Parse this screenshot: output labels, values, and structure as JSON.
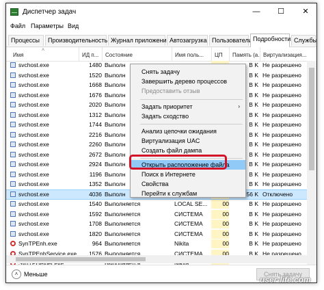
{
  "window": {
    "title": "Диспетчер задач",
    "minimize_glyph": "—",
    "maximize_glyph": "☐",
    "close_glyph": "✕"
  },
  "menu": [
    "Файл",
    "Параметры",
    "Вид"
  ],
  "tabs": [
    "Процессы",
    "Производительность",
    "Журнал приложений",
    "Автозагрузка",
    "Пользователи",
    "Подробности",
    "Службы"
  ],
  "active_tab": "Подробности",
  "columns": [
    "Имя",
    "ИД п...",
    "Состояние",
    "Имя поль...",
    "ЦП",
    "Память (а...",
    "Виртуализация..."
  ],
  "rows": [
    {
      "name": "svchost.exe",
      "pid": "1480",
      "status": "Выполн",
      "user": "",
      "cpu": "",
      "mem": "B K",
      "virt": "Не разрешено",
      "icon": "service"
    },
    {
      "name": "svchost.exe",
      "pid": "1520",
      "status": "Выполн",
      "user": "",
      "cpu": "",
      "mem": "B K",
      "virt": "Не разрешено",
      "icon": "service"
    },
    {
      "name": "svchost.exe",
      "pid": "1668",
      "status": "Выполн",
      "user": "",
      "cpu": "",
      "mem": "B K",
      "virt": "Не разрешено",
      "icon": "service"
    },
    {
      "name": "svchost.exe",
      "pid": "1676",
      "status": "Выполн",
      "user": "",
      "cpu": "",
      "mem": "B K",
      "virt": "Не разрешено",
      "icon": "service"
    },
    {
      "name": "svchost.exe",
      "pid": "2020",
      "status": "Выполн",
      "user": "",
      "cpu": "",
      "mem": "B K",
      "virt": "Не разрешено",
      "icon": "service"
    },
    {
      "name": "svchost.exe",
      "pid": "1312",
      "status": "Выполн",
      "user": "",
      "cpu": "",
      "mem": "B K",
      "virt": "Не разрешено",
      "icon": "service"
    },
    {
      "name": "svchost.exe",
      "pid": "1744",
      "status": "Выполн",
      "user": "",
      "cpu": "",
      "mem": "B K",
      "virt": "Не разрешено",
      "icon": "service"
    },
    {
      "name": "svchost.exe",
      "pid": "2216",
      "status": "Выполн",
      "user": "",
      "cpu": "",
      "mem": "B K",
      "virt": "Не разрешено",
      "icon": "service"
    },
    {
      "name": "svchost.exe",
      "pid": "2260",
      "status": "Выполн",
      "user": "",
      "cpu": "",
      "mem": "B K",
      "virt": "Не разрешено",
      "icon": "service"
    },
    {
      "name": "svchost.exe",
      "pid": "2672",
      "status": "Выполн",
      "user": "",
      "cpu": "",
      "mem": "B K",
      "virt": "Не разрешено",
      "icon": "service"
    },
    {
      "name": "svchost.exe",
      "pid": "2924",
      "status": "Выполн",
      "user": "",
      "cpu": "",
      "mem": "B K",
      "virt": "Не разрешено",
      "icon": "service"
    },
    {
      "name": "svchost.exe",
      "pid": "1196",
      "status": "Выполн",
      "user": "",
      "cpu": "",
      "mem": "B K",
      "virt": "Не разрешено",
      "icon": "service"
    },
    {
      "name": "svchost.exe",
      "pid": "1352",
      "status": "Выполн",
      "user": "",
      "cpu": "",
      "mem": "B K",
      "virt": "Не разрешено",
      "icon": "service"
    },
    {
      "name": "svchost.exe",
      "pid": "4036",
      "status": "Выполн",
      "user": "",
      "cpu": "",
      "mem": "6 556 K",
      "virt": "Отключено",
      "icon": "service",
      "selected": true
    },
    {
      "name": "svchost.exe",
      "pid": "1540",
      "status": "Выполняется",
      "user": "LOCAL SE...",
      "cpu": "00",
      "mem": "B K",
      "virt": "Не разрешено",
      "icon": "service"
    },
    {
      "name": "svchost.exe",
      "pid": "1592",
      "status": "Выполняется",
      "user": "СИСТЕМА",
      "cpu": "00",
      "mem": "B K",
      "virt": "Не разрешено",
      "icon": "service"
    },
    {
      "name": "svchost.exe",
      "pid": "1708",
      "status": "Выполняется",
      "user": "СИСТЕМА",
      "cpu": "00",
      "mem": "B K",
      "virt": "Не разрешено",
      "icon": "service"
    },
    {
      "name": "svchost.exe",
      "pid": "1820",
      "status": "Выполняется",
      "user": "СИСТЕМА",
      "cpu": "00",
      "mem": "B K",
      "virt": "Не разрешено",
      "icon": "service"
    },
    {
      "name": "SynTPEnh.exe",
      "pid": "964",
      "status": "Выполняется",
      "user": "Nikita",
      "cpu": "00",
      "mem": "B K",
      "virt": "Не разрешено",
      "icon": "synaptics"
    },
    {
      "name": "SynTPEnhService.exe",
      "pid": "1576",
      "status": "Выполняется",
      "user": "СИСТЕМА",
      "cpu": "00",
      "mem": "B K",
      "virt": "Не разрешено",
      "icon": "synaptics"
    },
    {
      "name": "SynTPHelper.exe",
      "pid": "",
      "status": "Выполняется",
      "user": "Nikita",
      "cpu": "",
      "mem": "",
      "virt": "",
      "icon": "synaptics"
    }
  ],
  "context_menu": {
    "items": [
      {
        "label": "Снять задачу"
      },
      {
        "label": "Завершить дерево процессов"
      },
      {
        "label": "Предоставить отзыв",
        "disabled": true
      },
      {
        "label": "Задать приоритет",
        "submenu": true
      },
      {
        "label": "Задать сходство"
      },
      {
        "label": "Анализ цепочки ожидания"
      },
      {
        "label": "Виртуализация UAC"
      },
      {
        "label": "Создать файл дампа"
      },
      {
        "label": "Открыть расположение файла",
        "highlighted": true
      },
      {
        "label": "Поиск в Интернете"
      },
      {
        "label": "Свойства"
      },
      {
        "label": "Перейти к службам"
      }
    ],
    "submenu_arrow": "›"
  },
  "footer": {
    "less_label": "Меньше",
    "less_glyph": "˄",
    "end_task_label": "Снять задачу"
  },
  "watermark": "user-life.com",
  "colors": {
    "highlight": "#91c9f7",
    "selected_row": "#cce8ff",
    "cpu_column": "#fff4c4",
    "callout": "#d3122a"
  }
}
